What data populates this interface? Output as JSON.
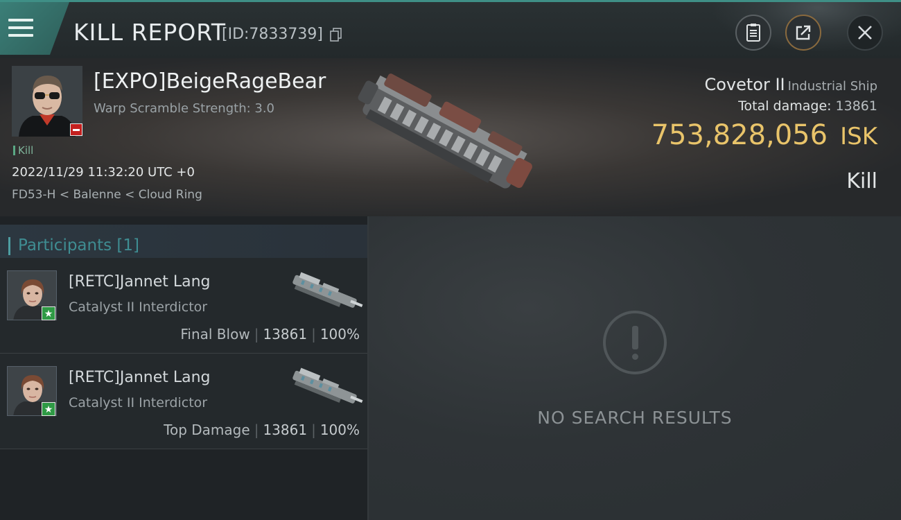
{
  "header": {
    "title": "KILL REPORT",
    "report_id": "[ID:7833739]",
    "icons": [
      "menu-icon",
      "copy-icon",
      "document-icon",
      "share-icon",
      "close-icon"
    ]
  },
  "victim": {
    "name": "[EXPO]BeigeRageBear",
    "warp_scramble": "Warp Scramble Strength: 3.0",
    "tag": "Kill",
    "datetime": "2022/11/29 11:32:20 UTC +0",
    "location": "FD53-H < Balenne < Cloud Ring",
    "ship_name": "Covetor II",
    "ship_class": "Industrial Ship",
    "total_damage_label": "Total damage:",
    "total_damage_value": "13861",
    "isk_value": "753,828,056",
    "isk_unit": "ISK",
    "result_label": "Kill"
  },
  "participants": {
    "title": "Participants [1]",
    "rows": [
      {
        "name": "[RETC]Jannet Lang",
        "ship": "Catalyst II Interdictor",
        "role": "Final Blow",
        "damage": "13861",
        "percent": "100%"
      },
      {
        "name": "[RETC]Jannet Lang",
        "ship": "Catalyst II Interdictor",
        "role": "Top Damage",
        "damage": "13861",
        "percent": "100%"
      }
    ]
  },
  "results": {
    "empty_message": "NO SEARCH RESULTS"
  },
  "colors": {
    "accent_teal": "#3f8f86",
    "isk_gold": "#e9c46a",
    "badge_red": "#c4201f",
    "badge_green": "#2f9a45"
  }
}
